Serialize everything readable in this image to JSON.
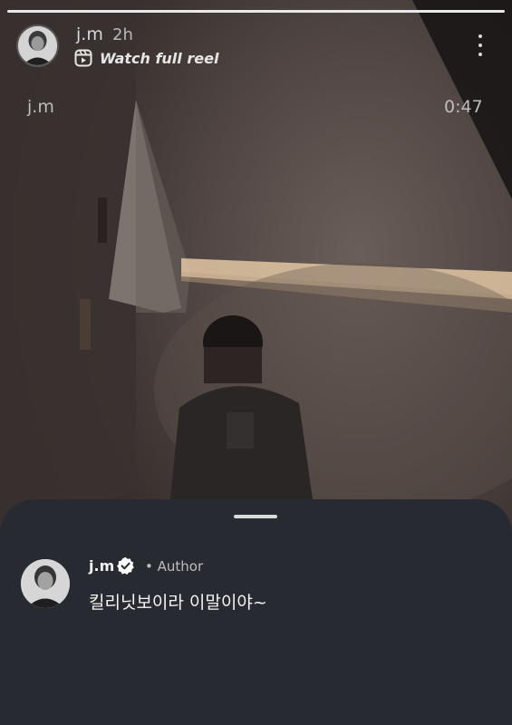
{
  "story": {
    "progress": 1.0,
    "username": "j.m",
    "posted_ago": "2h",
    "reel_link_label": "Watch full reel",
    "overlay_username": "j.m",
    "overlay_duration": "0:47"
  },
  "icons": {
    "reel": "reel-icon",
    "more": "more-vertical-icon",
    "verified": "verified-badge-icon"
  },
  "comment": {
    "username": "j.m",
    "author_label": "• Author",
    "text": "킬리닛보이라 이말이야~"
  },
  "colors": {
    "sheet_background": "#272a30",
    "verified_badge": "#ffffff"
  }
}
